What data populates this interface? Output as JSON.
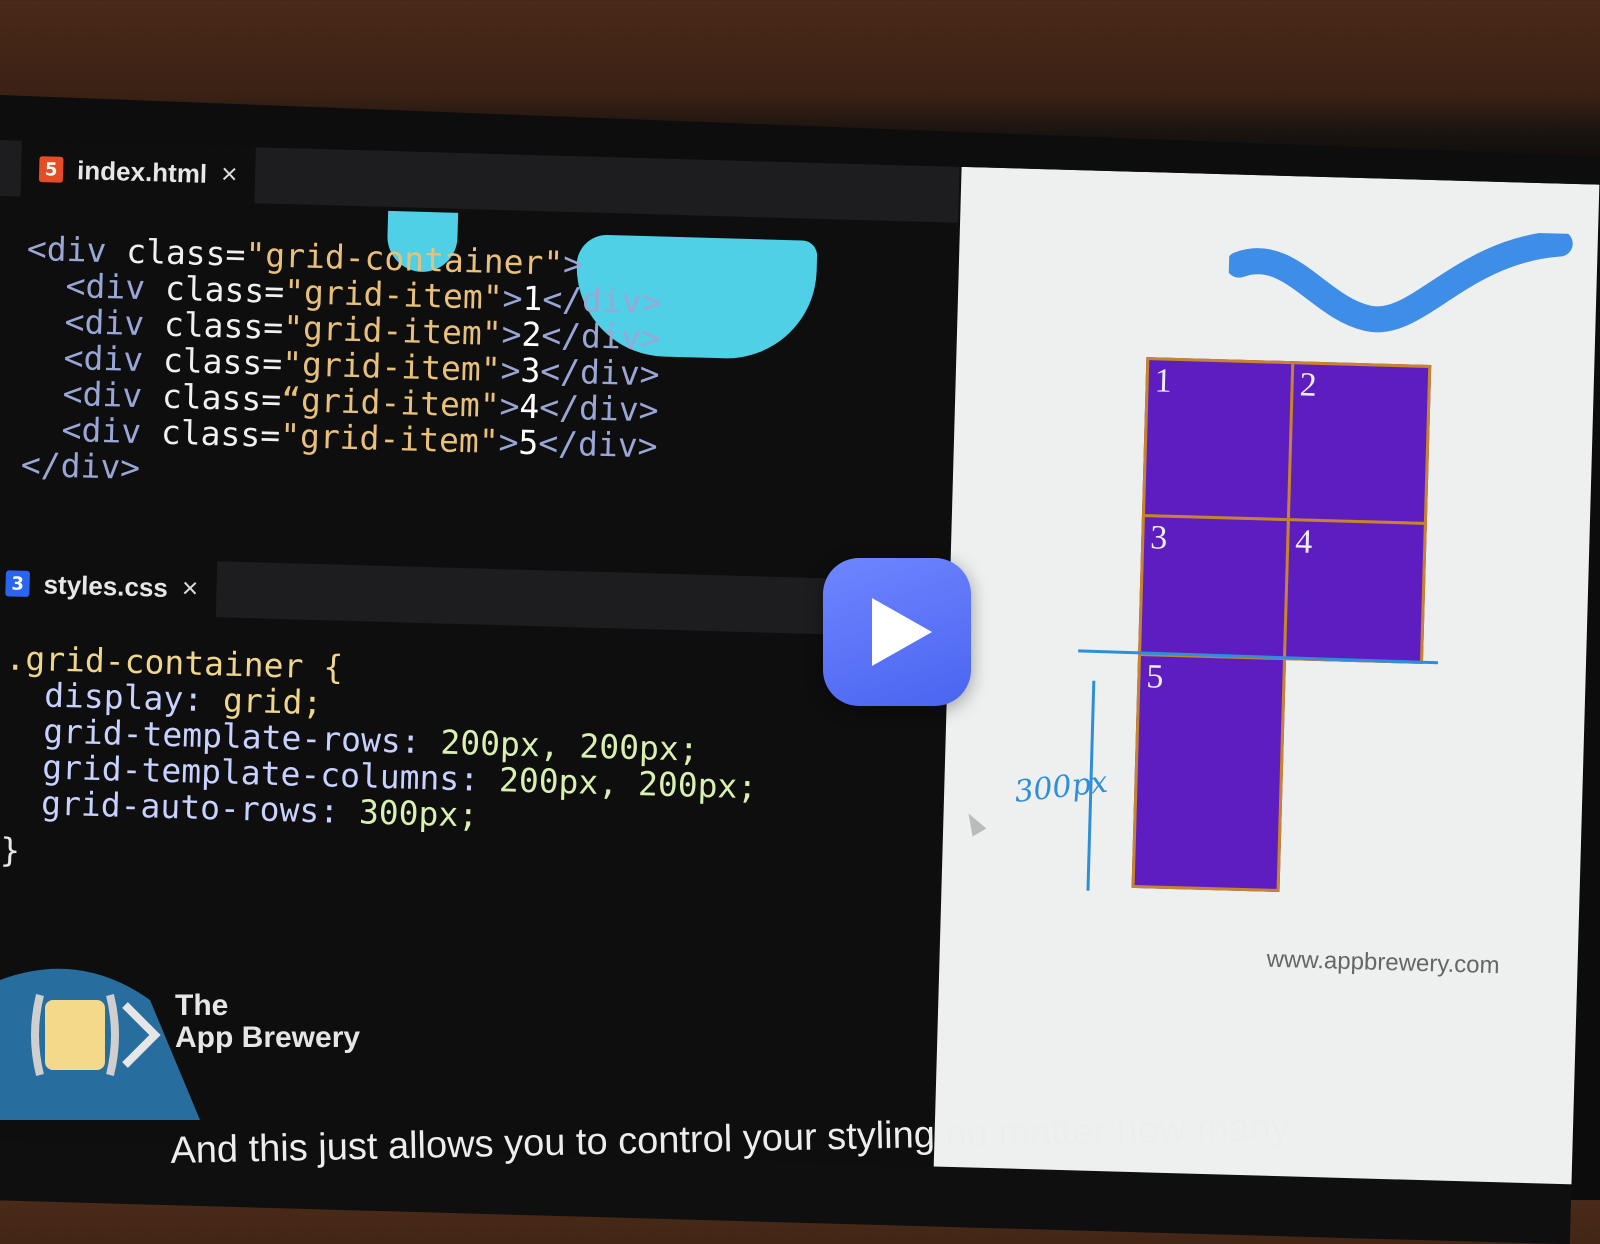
{
  "html_tab": {
    "icon": "html5-icon",
    "label": "index.html",
    "close": "×"
  },
  "css_tab": {
    "icon": "css3-icon",
    "label": "styles.css",
    "close": "×"
  },
  "html_code": {
    "l1": {
      "open": "<div",
      "attr": " class=",
      "val": "\"grid-container\"",
      "close": ">"
    },
    "items": [
      {
        "open": "<div",
        "attr": " class=",
        "val": "\"grid-item\"",
        "gt": ">",
        "text": "1",
        "end": "</div>"
      },
      {
        "open": "<div",
        "attr": " class=",
        "val": "\"grid-item\"",
        "gt": ">",
        "text": "2",
        "end": "</div>"
      },
      {
        "open": "<div",
        "attr": " class=",
        "val": "\"grid-item\"",
        "gt": ">",
        "text": "3",
        "end": "</div>"
      },
      {
        "open": "<div",
        "attr": " class=",
        "val": "“grid-item\"",
        "gt": ">",
        "text": "4",
        "end": "</div>"
      },
      {
        "open": "<div",
        "attr": " class=",
        "val": "\"grid-item\"",
        "gt": ">",
        "text": "5",
        "end": "</div>"
      }
    ],
    "last": "</div>"
  },
  "css_code": {
    "selector": ".grid-container {",
    "rules": [
      {
        "prop": "display:",
        "val": " grid;"
      },
      {
        "prop": "grid-template-rows:",
        "val": " 200px, 200px;"
      },
      {
        "prop": "grid-template-columns:",
        "val": " 200px, 200px;"
      },
      {
        "prop": "grid-auto-rows:",
        "val": " 300px;"
      }
    ],
    "close": "}"
  },
  "preview": {
    "items": [
      "1",
      "2",
      "3",
      "4",
      "5"
    ],
    "annotation": "300px",
    "site": "www.appbrewery.com",
    "colors": {
      "item": "#5e1dc0",
      "border": "#c7842e",
      "annotation": "#2f8ed8"
    }
  },
  "brand": {
    "line1": "The",
    "line2": "App Brewery"
  },
  "play_button": {
    "icon": "play-icon"
  },
  "caption": "And this just allows you to control your styling no matter how many"
}
